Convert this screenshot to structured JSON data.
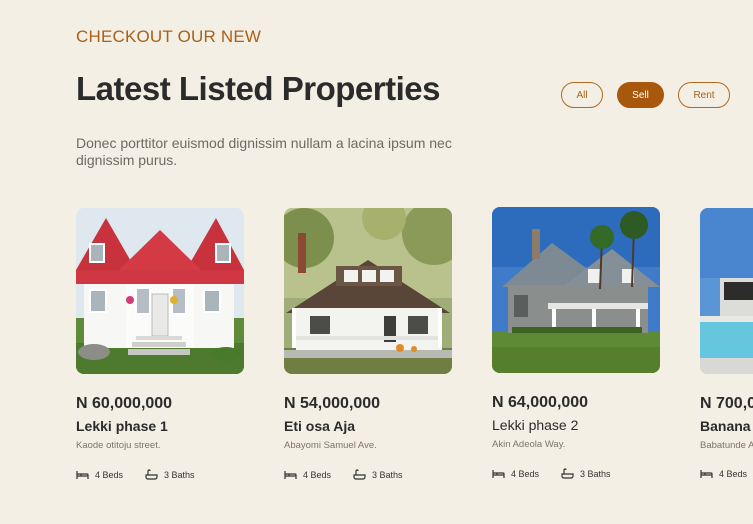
{
  "header": {
    "eyebrow": "CHECKOUT OUR NEW",
    "title": "Latest Listed Properties",
    "description": "Donec porttitor euismod dignissim nullam a lacina ipsum nec dignissim purus."
  },
  "filters": [
    {
      "label": "All",
      "active": false
    },
    {
      "label": "Sell",
      "active": true
    },
    {
      "label": "Rent",
      "active": false
    }
  ],
  "colors": {
    "accent": "#a8580d",
    "background": "#f4efe5"
  },
  "listings": [
    {
      "price": "N 60,000,000",
      "name": "Lekki phase 1",
      "address": "Kaode otitoju street.",
      "beds": "4 Beds",
      "baths": "3 Baths",
      "image": "white-house-red-roof"
    },
    {
      "price": "N 54,000,000",
      "name": "Eti osa Aja",
      "address": "Abayomi Samuel Ave.",
      "beds": "4 Beds",
      "baths": "3 Baths",
      "image": "white-cottage-brown-roof"
    },
    {
      "price": "N 64,000,000",
      "name": "Lekki phase 2",
      "address": "Akin Adeola Way.",
      "beds": "4 Beds",
      "baths": "3 Baths",
      "image": "grey-house-palm-trees"
    },
    {
      "price": "N 700,0",
      "name": "Banana",
      "address": "Babatunde A",
      "beds": "4 Beds",
      "baths": "",
      "image": "modern-villa-pool"
    }
  ]
}
